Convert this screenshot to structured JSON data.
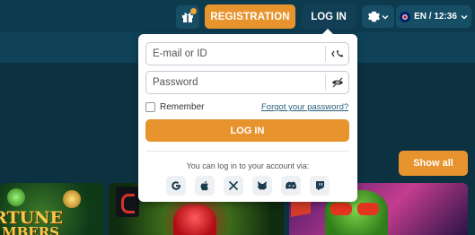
{
  "header": {
    "registration_label": "REGISTRATION",
    "login_label": "LOG IN",
    "language_label": "EN / 12:36",
    "gift_icon": "gift-icon",
    "settings_icon": "gear-icon",
    "flag_icon": "uk-flag-icon"
  },
  "main": {
    "show_all_label": "Show all",
    "games": [
      {
        "line1": "RTUNE",
        "line2": "MBERS"
      },
      {
        "line1": ""
      },
      {
        "line1": ""
      }
    ]
  },
  "login_form": {
    "email_placeholder": "E-mail or ID",
    "password_placeholder": "Password",
    "remember_label": "Remember",
    "forgot_label": "Forgot your password?",
    "submit_label": "LOG IN",
    "via_text": "You can log in to your account via:",
    "socials": [
      "google",
      "apple",
      "x",
      "metamask",
      "discord",
      "twitch"
    ]
  },
  "colors": {
    "accent": "#e8942e",
    "background": "#0c3242",
    "header": "#0e3a4e",
    "popup": "#ffffff"
  }
}
